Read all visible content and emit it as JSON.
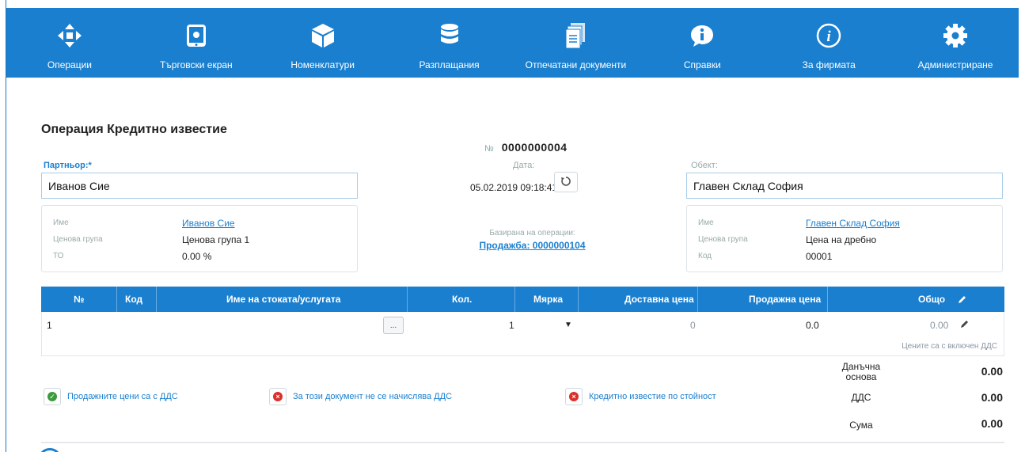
{
  "nav": [
    {
      "label": "Операции",
      "icon": "arrows-move-icon"
    },
    {
      "label": "Търговски екран",
      "icon": "tablet-icon"
    },
    {
      "label": "Номенклатури",
      "icon": "cube-icon"
    },
    {
      "label": "Разплащания",
      "icon": "database-icon"
    },
    {
      "label": "Отпечатани документи",
      "icon": "documents-icon"
    },
    {
      "label": "Справки",
      "icon": "info-bubble-icon"
    },
    {
      "label": "За фирмата",
      "icon": "info-circle-icon"
    },
    {
      "label": "Администриране",
      "icon": "gear-icon"
    }
  ],
  "page": {
    "title": "Операция Кредитно известие",
    "number_prefix": "№",
    "number": "0000000004",
    "partner_label": "Партньор:*",
    "partner_value": "Иванов Сие",
    "date_label": "Дата:",
    "date_value": "05.02.2019 09:18:41",
    "obekt_label": "Обект:",
    "obekt_value": "Главен Склад София",
    "based_label": "Базирана на операции:",
    "based_link": "Продажба: 0000000104"
  },
  "partner_card": {
    "name_label": "Име",
    "name_value": "Иванов Сие",
    "price_group_label": "Ценова група",
    "price_group_value": "Ценова група 1",
    "to_label": "ТО",
    "to_value": "0.00 %"
  },
  "obekt_card": {
    "name_label": "Име",
    "name_value": "Главен Склад София",
    "price_group_label": "Ценова група",
    "price_group_value": "Цена на дребно",
    "code_label": "Код",
    "code_value": "00001"
  },
  "table": {
    "headers": {
      "num": "№",
      "code": "Код",
      "name": "Име на стоката/услугата",
      "qty": "Кол.",
      "unit": "Мярка",
      "delivery": "Доставна цена",
      "sale": "Продажна цена",
      "total": "Общо"
    },
    "row": {
      "num": "1",
      "dots": "...",
      "qty": "1",
      "unit_arrow": "▼",
      "delivery": "0",
      "sale": "0.0",
      "total": "0.00"
    },
    "prices_note": "Цените са с включен ДДС"
  },
  "options": {
    "vat_prices": "Продажните цени са с ДДС",
    "no_vat": "За този документ не се начислява ДДС",
    "credit_by_value": "Кредитно известие по стойност"
  },
  "totals": {
    "base_label": "Данъчна основа",
    "base_value": "0.00",
    "vat_label": "ДДС",
    "vat_value": "0.00",
    "sum_label": "Сума",
    "sum_value": "0.00"
  },
  "colors": {
    "accent": "#1a7fcf",
    "ok": "#3c9a3c",
    "error": "#d9302c"
  }
}
